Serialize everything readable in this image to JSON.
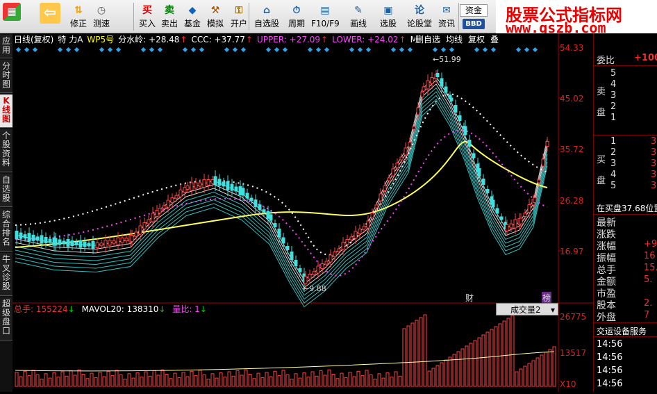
{
  "toolbar": {
    "buttons": [
      {
        "label": "",
        "icon": "app-grid-icon",
        "color": "#e03030"
      },
      {
        "label": "",
        "icon": "back-arrow-icon",
        "color": "#f0a000"
      },
      {
        "label": "修正",
        "icon": "up-down-arrows-icon",
        "color": "#f0a000"
      },
      {
        "label": "测速",
        "icon": "clock-icon",
        "color": "#555555"
      },
      {
        "label": "买入",
        "icon": "buy-icon",
        "glyph": "买",
        "color": "#d00000"
      },
      {
        "label": "卖出",
        "icon": "sell-icon",
        "glyph": "卖",
        "color": "#008000"
      },
      {
        "label": "基金",
        "icon": "fund-icon",
        "color": "#1060c0"
      },
      {
        "label": "模拟",
        "icon": "hammer-icon",
        "color": "#a05000"
      },
      {
        "label": "开户",
        "icon": "lock-icon",
        "color": "#a07000"
      },
      {
        "label": "自选股",
        "icon": "home-icon",
        "color": "#2060a0"
      },
      {
        "label": "周期",
        "icon": "period-icon",
        "color": "#2060a0"
      },
      {
        "label": "F10/F9",
        "icon": "f10-icon",
        "color": "#2060a0"
      },
      {
        "label": "画线",
        "icon": "pencil-icon",
        "color": "#2060a0"
      },
      {
        "label": "选股",
        "icon": "select-stock-icon",
        "color": "#2060a0"
      },
      {
        "label": "论股堂",
        "icon": "forum-icon",
        "glyph": "论",
        "color": "#2060a0"
      },
      {
        "label": "资讯",
        "icon": "news-icon",
        "color": "#2060a0"
      }
    ],
    "fund_label": "资金",
    "bbd_label": "BBD"
  },
  "brand": {
    "line1": "股票公式指标网",
    "line2": "www.gszb.com"
  },
  "sidetabs": [
    {
      "label": "应用",
      "active": false
    },
    {
      "label": "分时图",
      "active": false
    },
    {
      "label": "K线图",
      "active": true
    },
    {
      "label": "个股资料",
      "active": false
    },
    {
      "label": "自选股",
      "active": false
    },
    {
      "label": "综合排名",
      "active": false
    },
    {
      "label": "牛叉诊股",
      "active": false
    },
    {
      "label": "超级盘口",
      "active": false
    }
  ],
  "infobar": {
    "title": "日线(复权)",
    "formula": "特 力A",
    "indicator": "WP5号",
    "items": [
      {
        "text": "分水岭: +28.48",
        "arrow": "↑",
        "color": "#ffffff"
      },
      {
        "text": "CCC: +37.77",
        "arrow": "↑",
        "color": "#ffffff"
      },
      {
        "text": "UPPER: +27.09",
        "arrow": "↑",
        "color": "#ff44ff"
      },
      {
        "text": "LOWER: +24.02",
        "arrow": "↑",
        "color": "#ff44ff"
      },
      {
        "text": "MID: +",
        "arrow": "",
        "color": "#ffffff"
      }
    ],
    "buttons": [
      "删自选",
      "均线",
      "复权",
      "叠"
    ]
  },
  "price_axis": [
    "54.33",
    "45.02",
    "35.72",
    "26.28",
    "16.97"
  ],
  "price_marks": {
    "high": "51.99",
    "low": "9.88"
  },
  "badges": {
    "cai": "财",
    "bang": "榜"
  },
  "volume": {
    "total_label": "总手: 155224",
    "total_arrow": "↓",
    "mavol_label": "MAVOL20: 138310",
    "mavol_arrow": "↓",
    "ratio_label": "量比: 1",
    "ratio_arrow": "↓",
    "selector": "成交量2",
    "axis": [
      "26775",
      "13517",
      "X10"
    ]
  },
  "right_panel": {
    "weibi_label": "委比",
    "weibi_value": "+100",
    "sell_label": "卖盘",
    "sell_rows": [
      "5",
      "4",
      "3",
      "2",
      "1"
    ],
    "buy_label": "买盘",
    "buy_rows": [
      "1",
      "2",
      "3",
      "4",
      "5"
    ],
    "buy_note": "在买盘37.68位置",
    "stats": [
      {
        "label": "最新",
        "value": ""
      },
      {
        "label": "涨跌",
        "value": ""
      },
      {
        "label": "涨幅",
        "value": "+9"
      },
      {
        "label": "振幅",
        "value": "16"
      },
      {
        "label": "总手",
        "value": "15."
      },
      {
        "label": "金额",
        "value": "5."
      },
      {
        "label": "市盈",
        "value": ""
      },
      {
        "label": "股本",
        "value": "2."
      },
      {
        "label": "外盘",
        "value": "7"
      }
    ],
    "ticker_title": "交运设备服务",
    "times": [
      "14:56",
      "14:56",
      "14:56",
      "14:56"
    ]
  }
}
